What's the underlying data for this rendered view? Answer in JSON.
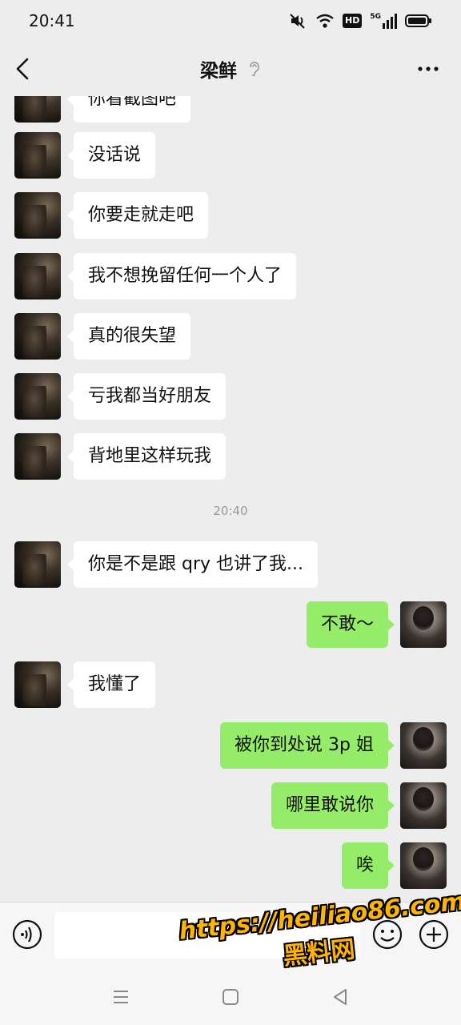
{
  "status_bar": {
    "time": "20:41",
    "hd_label": "HD",
    "network_label": "5G"
  },
  "header": {
    "title": "梁鲜"
  },
  "messages": [
    {
      "side": "left",
      "text": "你看截图吧"
    },
    {
      "side": "left",
      "text": "没话说"
    },
    {
      "side": "left",
      "text": "你要走就走吧"
    },
    {
      "side": "left",
      "text": "我不想挽留任何一个人了"
    },
    {
      "side": "left",
      "text": "真的很失望"
    },
    {
      "side": "left",
      "text": "亏我都当好朋友"
    },
    {
      "side": "left",
      "text": "背地里这样玩我"
    },
    {
      "side": "time",
      "text": "20:40"
    },
    {
      "side": "left",
      "text": "你是不是跟 qry 也讲了我..."
    },
    {
      "side": "right",
      "text": "不敢～"
    },
    {
      "side": "left",
      "text": "我懂了"
    },
    {
      "side": "right",
      "text": "被你到处说 3p 姐"
    },
    {
      "side": "right",
      "text": "哪里敢说你"
    },
    {
      "side": "right",
      "text": "唉"
    }
  ],
  "input": {
    "value": "",
    "placeholder": ""
  },
  "watermark": {
    "url": "https://heiliao86.com",
    "name": "黑料网"
  },
  "colors": {
    "background": "#ededed",
    "incoming_bubble": "#ffffff",
    "outgoing_bubble": "#95ec69",
    "watermark": "#ffb400"
  },
  "icons": {
    "back": "chevron-left-icon",
    "ear": "ear-icon",
    "more": "more-dots-icon",
    "voice": "voice-icon",
    "emoji": "emoji-icon",
    "plus": "plus-circle-icon"
  }
}
